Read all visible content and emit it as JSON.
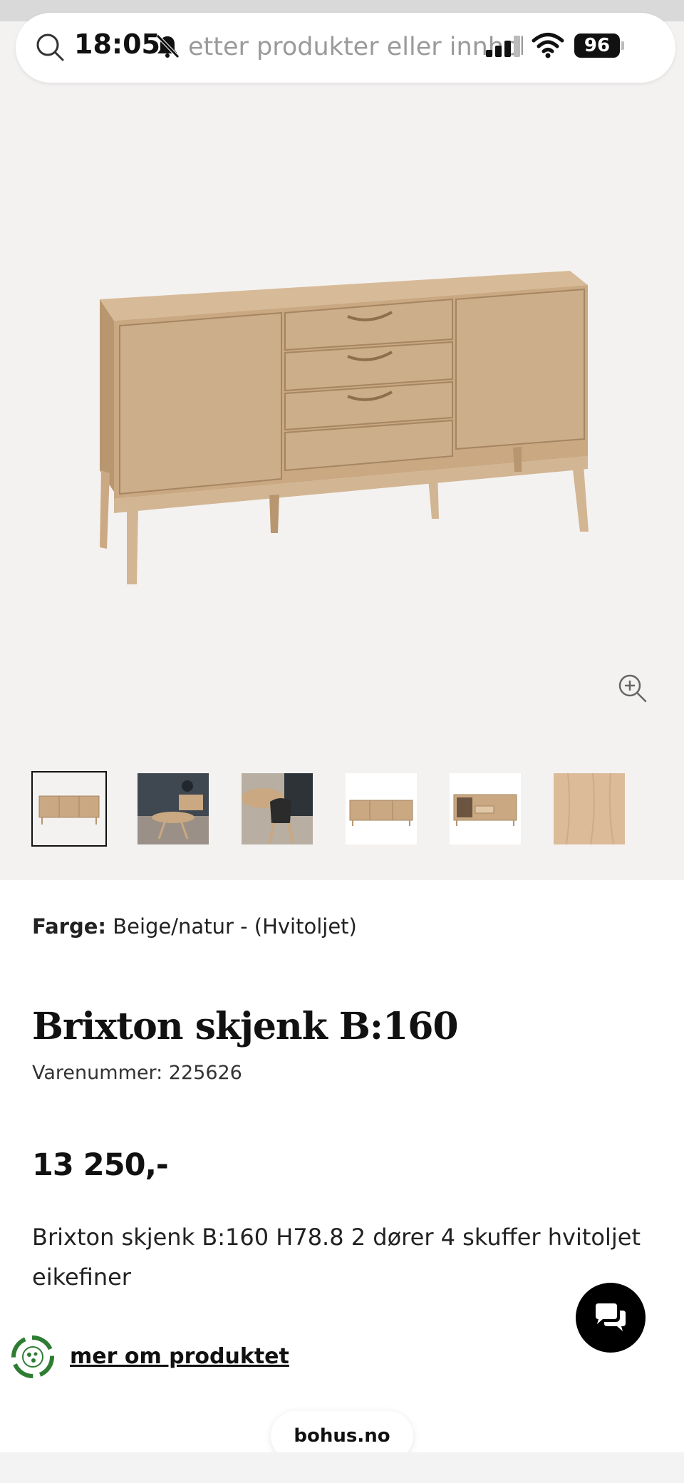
{
  "status_bar": {
    "time": "18:05",
    "battery": "96",
    "icons": [
      "bell-muted-icon",
      "signal-icon",
      "wifi-icon"
    ]
  },
  "search": {
    "placeholder": "etter produkter eller innhold",
    "icon": "search-icon"
  },
  "gallery": {
    "zoom_icon": "zoom-in-icon",
    "thumbnails": [
      {
        "name": "thumb-sideboard-front",
        "active": true
      },
      {
        "name": "thumb-dining-room"
      },
      {
        "name": "thumb-chairs"
      },
      {
        "name": "thumb-sideboard-front-small"
      },
      {
        "name": "thumb-sideboard-open"
      },
      {
        "name": "thumb-wood-swatch"
      }
    ]
  },
  "product": {
    "color_label": "Farge:",
    "color_value": "Beige/natur - (Hvitoljet)",
    "title": "Brixton skjenk B:160",
    "sku": "Varenummer: 225626",
    "price": "13 250,-",
    "description": "Brixton skjenk B:160 H78.8 2 dører 4 skuffer hvitoljet eikefiner",
    "more_link": "mer om produktet"
  },
  "browser": {
    "url": "bohus.no"
  },
  "colors": {
    "gallery_bg": "#f4f2f1",
    "wood": "#c9a882",
    "chat_bg": "#000000",
    "eco_green": "#2e7d32"
  }
}
